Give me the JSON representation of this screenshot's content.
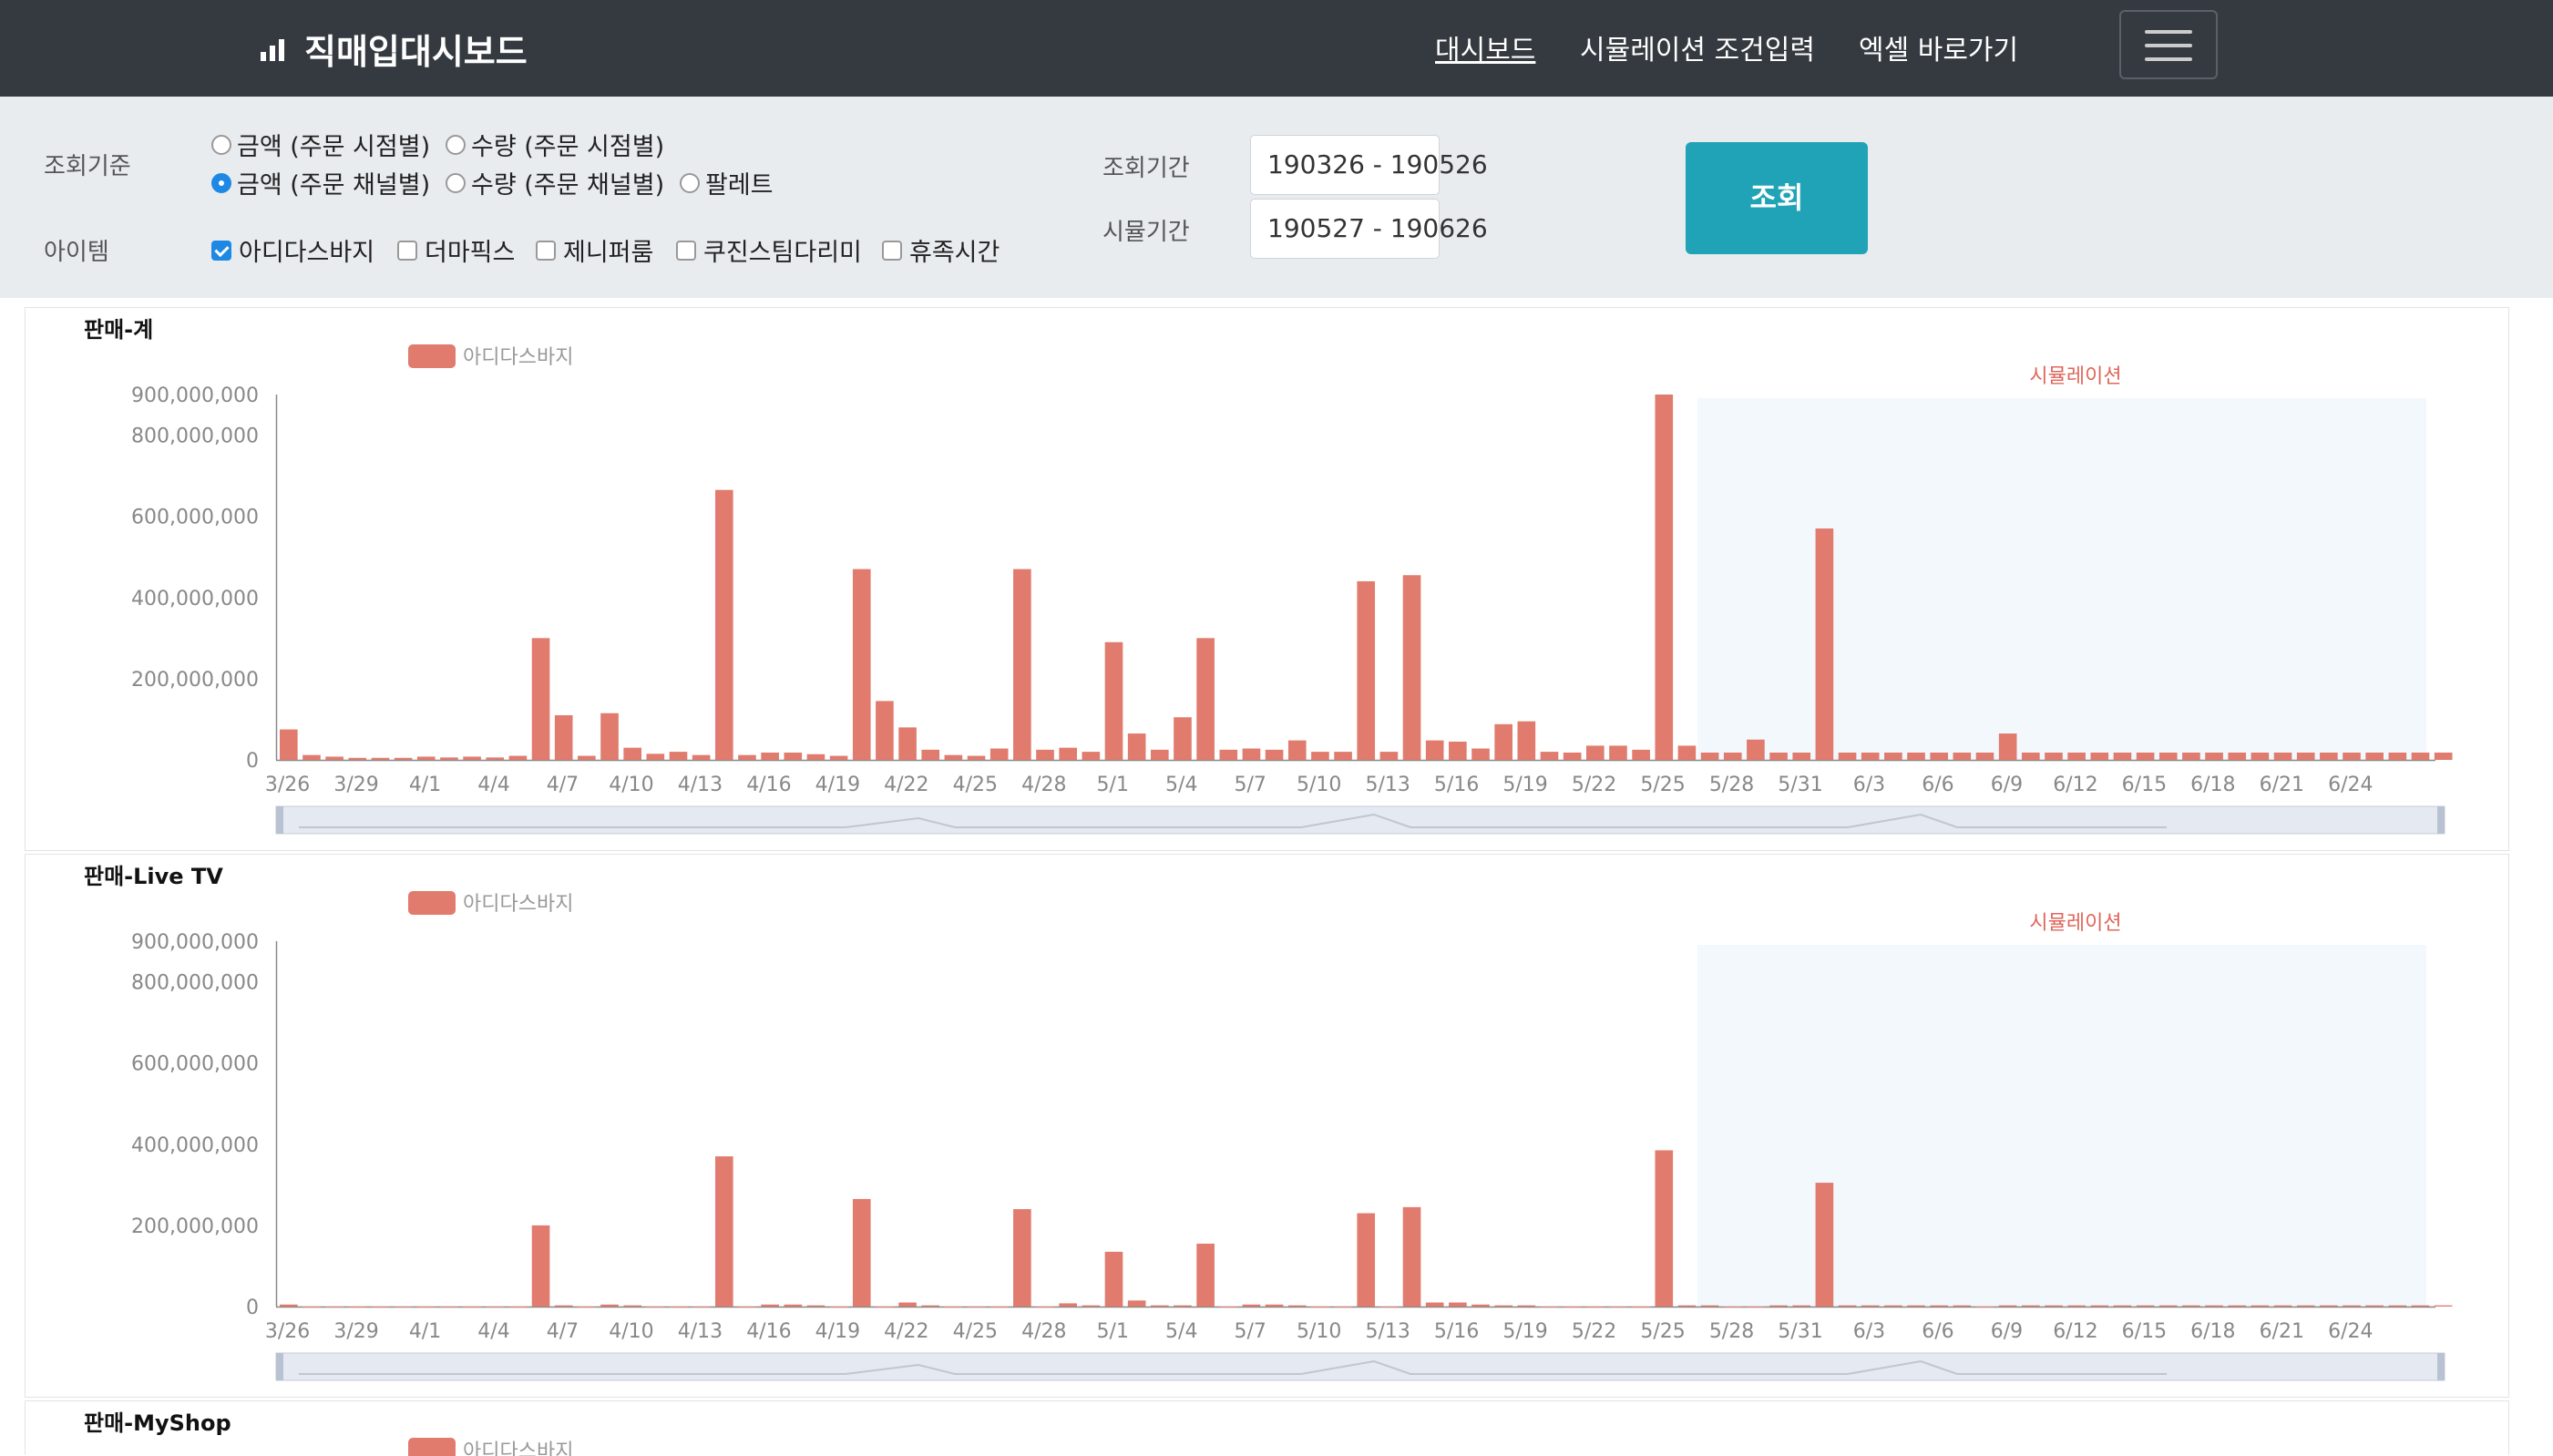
{
  "navbar": {
    "brand": "직매입대시보드",
    "links": [
      "대시보드",
      "시뮬레이션 조건입력",
      "엑셀 바로가기"
    ]
  },
  "filter": {
    "criteria_label": "조회기준",
    "criteria_options": [
      "금액 (주문 시점별)",
      "수량 (주문 시점별)",
      "금액 (주문 채널별)",
      "수량 (주문 채널별)",
      "팔레트"
    ],
    "criteria_selected": "금액 (주문 채널별)",
    "item_label": "아이템",
    "items": [
      {
        "label": "아디다스바지",
        "checked": true
      },
      {
        "label": "더마픽스",
        "checked": false
      },
      {
        "label": "제니퍼룸",
        "checked": false
      },
      {
        "label": "쿠진스팀다리미",
        "checked": false
      },
      {
        "label": "휴족시간",
        "checked": false
      }
    ],
    "query_period_label": "조회기간",
    "query_period_value": "190326 - 190526",
    "sim_period_label": "시뮬기간",
    "sim_period_value": "190527 - 190626",
    "query_button": "조회"
  },
  "colors": {
    "bar": "#e07b6e",
    "sim_band": "#f3f8fd",
    "sim_label": "#e0665a",
    "navbar": "#343a40",
    "panel": "#e9ecef",
    "button": "#21a3b7"
  },
  "chart_data": [
    {
      "type": "bar",
      "title": "판매-계",
      "legend": "아디다스바지",
      "annotation": "시뮬레이션",
      "simulation_start": "5/27",
      "ylim": [
        0,
        900000000
      ],
      "yticks": [
        "900,000,000",
        "800,000,000",
        "600,000,000",
        "400,000,000",
        "200,000,000",
        "0"
      ],
      "xticks": [
        "3/26",
        "3/29",
        "4/1",
        "4/4",
        "4/7",
        "4/10",
        "4/13",
        "4/16",
        "4/19",
        "4/22",
        "4/25",
        "4/28",
        "5/1",
        "5/4",
        "5/7",
        "5/10",
        "5/13",
        "5/16",
        "5/19",
        "5/22",
        "5/25",
        "5/28",
        "5/31",
        "6/3",
        "6/6",
        "6/9",
        "6/12",
        "6/15",
        "6/18",
        "6/21",
        "6/24"
      ],
      "values": [
        75,
        12,
        8,
        5,
        5,
        5,
        8,
        6,
        8,
        6,
        10,
        300,
        110,
        10,
        115,
        30,
        15,
        20,
        12,
        665,
        12,
        18,
        18,
        14,
        10,
        470,
        145,
        80,
        25,
        12,
        10,
        28,
        470,
        25,
        30,
        20,
        290,
        65,
        25,
        105,
        300,
        25,
        28,
        25,
        48,
        20,
        20,
        440,
        20,
        455,
        48,
        45,
        28,
        88,
        95,
        20,
        18,
        35,
        35,
        25,
        900,
        35,
        18,
        18,
        50,
        18,
        18,
        570,
        18,
        18,
        18,
        18,
        18,
        18,
        18,
        65,
        18,
        18,
        18,
        18,
        18,
        18,
        18,
        18,
        18,
        18,
        18,
        18,
        18,
        18,
        18,
        18,
        18,
        18,
        18
      ]
    },
    {
      "type": "bar",
      "title": "판매-Live TV",
      "legend": "아디다스바지",
      "annotation": "시뮬레이션",
      "simulation_start": "5/27",
      "ylim": [
        0,
        900000000
      ],
      "yticks": [
        "900,000,000",
        "800,000,000",
        "600,000,000",
        "400,000,000",
        "200,000,000",
        "0"
      ],
      "xticks": [
        "3/26",
        "3/29",
        "4/1",
        "4/4",
        "4/7",
        "4/10",
        "4/13",
        "4/16",
        "4/19",
        "4/22",
        "4/25",
        "4/28",
        "5/1",
        "5/4",
        "5/7",
        "5/10",
        "5/13",
        "5/16",
        "5/19",
        "5/22",
        "5/25",
        "5/28",
        "5/31",
        "6/3",
        "6/6",
        "6/9",
        "6/12",
        "6/15",
        "6/18",
        "6/21",
        "6/24"
      ],
      "values": [
        5,
        0,
        0,
        0,
        0,
        0,
        0,
        0,
        0,
        0,
        0,
        200,
        3,
        0,
        5,
        3,
        0,
        0,
        0,
        370,
        0,
        5,
        5,
        3,
        0,
        265,
        0,
        10,
        3,
        0,
        0,
        0,
        240,
        0,
        8,
        3,
        135,
        15,
        3,
        3,
        155,
        0,
        5,
        5,
        3,
        0,
        0,
        230,
        0,
        245,
        10,
        10,
        5,
        3,
        3,
        0,
        0,
        0,
        0,
        0,
        385,
        3,
        3,
        0,
        0,
        3,
        3,
        305,
        3,
        3,
        3,
        3,
        3,
        3,
        0,
        3,
        3,
        3,
        3,
        3,
        3,
        3,
        3,
        3,
        3,
        3,
        3,
        3,
        3,
        3,
        3,
        3,
        3,
        3,
        3
      ]
    },
    {
      "type": "bar",
      "title": "판매-MyShop",
      "legend": "아디다스바지"
    }
  ]
}
